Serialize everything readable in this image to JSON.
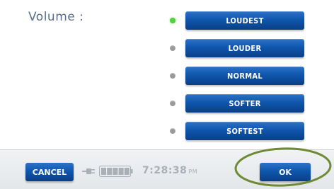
{
  "screen": {
    "title": "Volume :"
  },
  "volume_options": [
    {
      "label": "LOUDEST",
      "selected": true
    },
    {
      "label": "LOUDER",
      "selected": false
    },
    {
      "label": "NORMAL",
      "selected": false
    },
    {
      "label": "SOFTER",
      "selected": false
    },
    {
      "label": "SOFTEST",
      "selected": false
    }
  ],
  "footer": {
    "cancel_label": "CANCEL",
    "time": "7:28:38",
    "ampm": "PM",
    "ok_label": "OK",
    "plug_icon": "plug-icon",
    "battery_icon": "battery-icon",
    "battery_level": 1.0
  },
  "colors": {
    "button_blue": "#0f56ad",
    "radio_selected": "#4ed13c",
    "radio_unselected": "#9a9a9a",
    "title_text": "#5a6f8a",
    "highlight_circle": "#6e8a35"
  }
}
